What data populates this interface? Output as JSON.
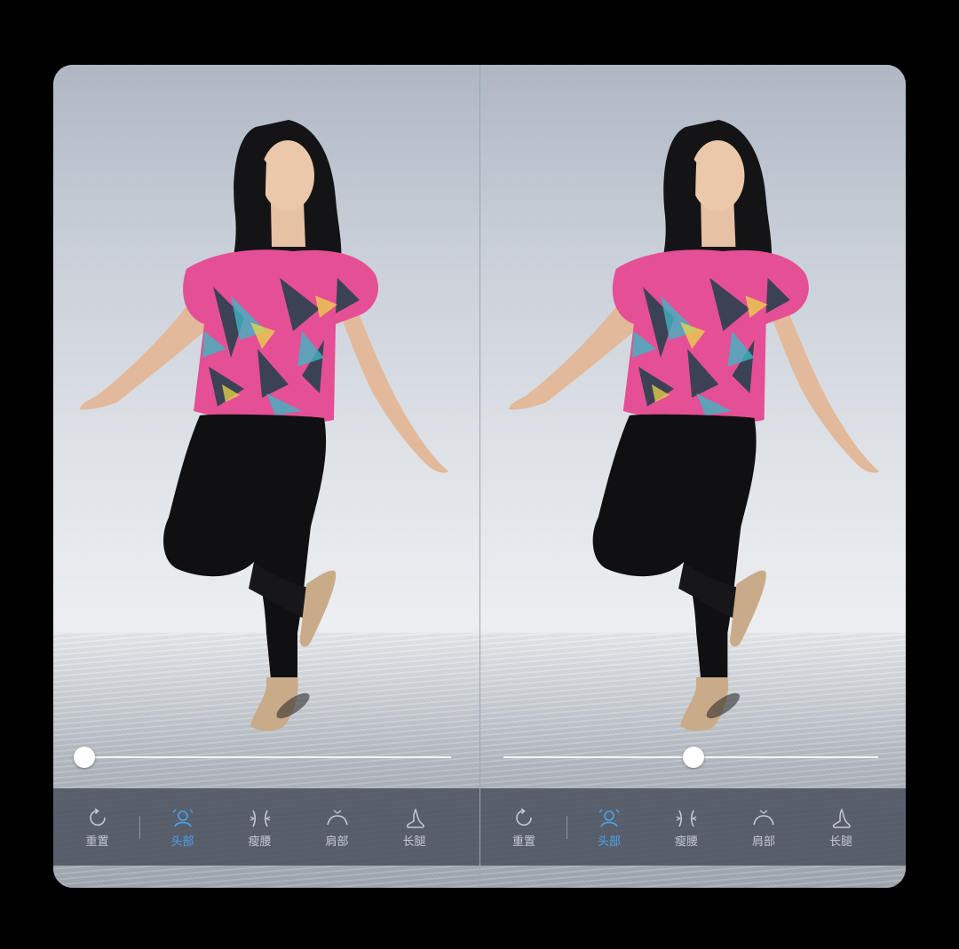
{
  "panels": [
    {
      "id": "before",
      "slider": {
        "value": 0
      },
      "toolbar": {
        "reset_label": "重置",
        "items": [
          {
            "label": "头部",
            "icon": "head-icon",
            "active": true
          },
          {
            "label": "瘦腰",
            "icon": "waist-icon",
            "active": false
          },
          {
            "label": "肩部",
            "icon": "shoulder-icon",
            "active": false
          },
          {
            "label": "长腿",
            "icon": "high-heel-icon",
            "active": false
          }
        ]
      }
    },
    {
      "id": "after",
      "slider": {
        "value": 0.5
      },
      "toolbar": {
        "reset_label": "重置",
        "items": [
          {
            "label": "头部",
            "icon": "head-icon",
            "active": true
          },
          {
            "label": "瘦腰",
            "icon": "waist-icon",
            "active": false
          },
          {
            "label": "肩部",
            "icon": "shoulder-icon",
            "active": false
          },
          {
            "label": "长腿",
            "icon": "high-heel-icon",
            "active": false
          }
        ]
      }
    }
  ],
  "colors": {
    "active": "#4aa3ee",
    "inactive": "#c4c9d0",
    "toolbar_bg": "#4a525e"
  }
}
